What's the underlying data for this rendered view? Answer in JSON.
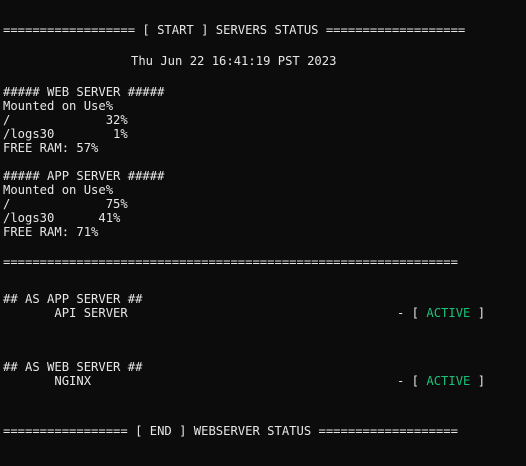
{
  "terminal": {
    "start_banner": "================== [ START ] SERVERS STATUS ===================",
    "date": "Thu Jun 22 16:41:19 PST 2023",
    "web": {
      "header": "##### WEB SERVER #####",
      "columns": "Mounted on Use%",
      "rows": [
        "/             32%",
        "/logs30        1%"
      ],
      "free_ram": "FREE RAM: 57%"
    },
    "app": {
      "header": "##### APP SERVER #####",
      "columns": "Mounted on Use%",
      "rows": [
        "/             75%",
        "/logs30      41%"
      ],
      "free_ram": "FREE RAM: 71%"
    },
    "divider": "==============================================================",
    "as_app": {
      "header": "## AS APP SERVER ##",
      "service": "       API SERVER",
      "status_prefix": "- [ ",
      "status": "ACTIVE",
      "status_suffix": " ]"
    },
    "as_web": {
      "header": "## AS WEB SERVER ##",
      "service": "       NGINX",
      "status_prefix": "- [ ",
      "status": "ACTIVE",
      "status_suffix": " ]"
    },
    "end_banner": "================= [ END ] WEBSERVER STATUS ===================",
    "colors": {
      "background": "#0c0c0c",
      "text": "#e6e6e6",
      "active": "#19c27a"
    }
  }
}
